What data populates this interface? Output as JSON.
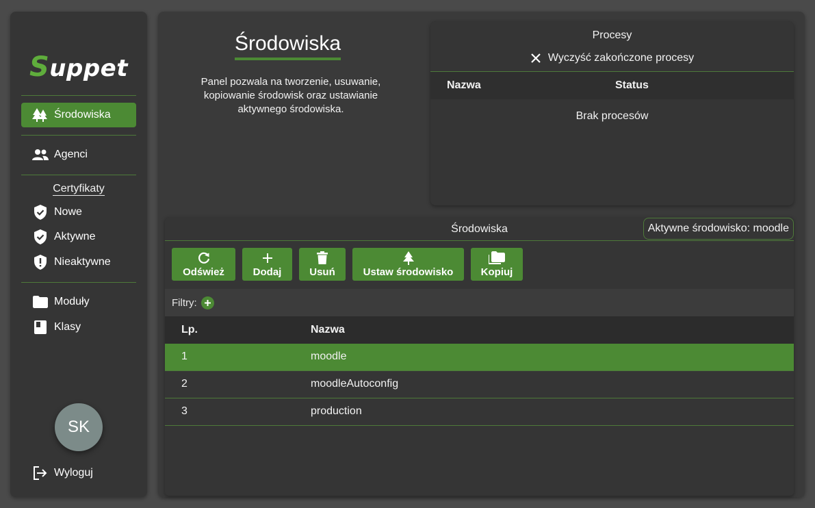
{
  "sidebar": {
    "logo_first": "S",
    "logo_rest": "uppet",
    "nav": {
      "environments": "Środowiska",
      "agents": "Agenci",
      "certificates_title": "Certyfikaty",
      "cert_new": "Nowe",
      "cert_active": "Aktywne",
      "cert_inactive": "Nieaktywne",
      "modules": "Moduły",
      "classes": "Klasy"
    },
    "avatar_initials": "SK",
    "logout": "Wyloguj"
  },
  "page": {
    "title": "Środowiska",
    "description": "Panel pozwala na tworzenie, usuwanie, kopiowanie środowisk oraz ustawianie aktywnego środowiska."
  },
  "processes": {
    "title": "Procesy",
    "clear_label": "Wyczyść zakończone procesy",
    "col_name": "Nazwa",
    "col_status": "Status",
    "empty": "Brak procesów"
  },
  "environments": {
    "title": "Środowiska",
    "active_label": "Aktywne środowisko: moodle",
    "buttons": {
      "refresh": "Odśwież",
      "add": "Dodaj",
      "delete": "Usuń",
      "set": "Ustaw środowisko",
      "copy": "Kopiuj"
    },
    "filters_label": "Filtry:",
    "columns": {
      "no": "Lp.",
      "name": "Nazwa"
    },
    "rows": [
      {
        "no": "1",
        "name": "moodle",
        "selected": true
      },
      {
        "no": "2",
        "name": "moodleAutoconfig",
        "selected": false
      },
      {
        "no": "3",
        "name": "production",
        "selected": false
      }
    ]
  },
  "colors": {
    "accent": "#4c8a34",
    "panel": "#353535",
    "background": "#4a4a4a"
  }
}
